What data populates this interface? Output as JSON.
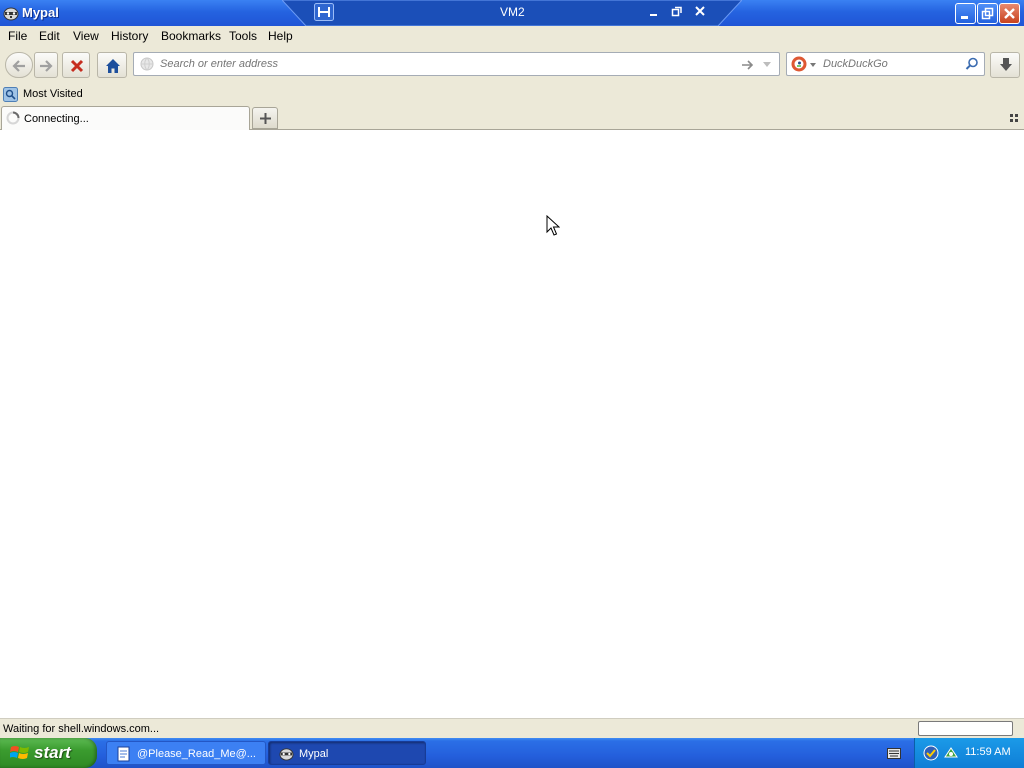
{
  "window": {
    "title": "Mypal",
    "vm_label": "VM2",
    "app_icon": "raccoon-icon"
  },
  "menu": {
    "items": [
      {
        "label": "File"
      },
      {
        "label": "Edit"
      },
      {
        "label": "View"
      },
      {
        "label": "History"
      },
      {
        "label": "Bookmarks"
      },
      {
        "label": "Tools"
      },
      {
        "label": "Help"
      }
    ]
  },
  "toolbar": {
    "url_placeholder": "Search or enter address",
    "url_value": "",
    "search_placeholder": "DuckDuckGo",
    "search_value": ""
  },
  "bookmarks": {
    "items": [
      {
        "label": "Most Visited"
      }
    ]
  },
  "tabs": {
    "items": [
      {
        "label": "Connecting..."
      }
    ]
  },
  "status": {
    "text": "Waiting for shell.windows.com..."
  },
  "taskbar": {
    "start_label": "start",
    "tasks": [
      {
        "label": "@Please_Read_Me@..."
      },
      {
        "label": "Mypal"
      }
    ],
    "clock": "11:59 AM"
  },
  "colors": {
    "titlebar": "#2563e0",
    "chrome": "#ece9d8",
    "taskbar": "#245fdc",
    "start_green": "#3b9c2f",
    "stop_red": "#c62d1f",
    "home_blue": "#1d4f9c"
  }
}
